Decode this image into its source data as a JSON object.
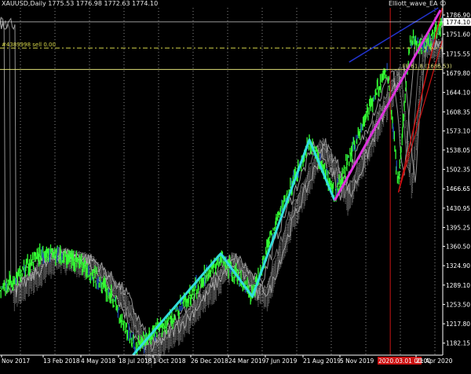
{
  "header": {
    "symbol_info": "XAUUSD,Daily  1775.53 1776.98 1772.63 1774.10",
    "ea_name": "Elliott_wave_EA ☺"
  },
  "order_line_label": "#4389998 sell 0.00",
  "fib_label": "FE 61.8 (1686.53)",
  "time_marker_label": "2020.03.01 00:00",
  "colors": {
    "background": "#000000",
    "price_axis": "#ffffff",
    "bull_candle": "#33ff33",
    "wave_primary": "#33dddd",
    "wave_secondary": "#dd33dd",
    "trend_blue": "#2233cc",
    "trend_red": "#cc1111",
    "cloud": "#bbbbbb",
    "order_line": "#d8d84a",
    "fib_line": "#e0e07a"
  },
  "chart_data": {
    "type": "line",
    "symbol": "XAUUSD",
    "timeframe": "Daily",
    "price_axis": {
      "ticks": [
        1786.9,
        1774.1,
        1751.6,
        1715.55,
        1679.8,
        1644.1,
        1608.35,
        1573.1,
        1538.05,
        1502.35,
        1466.65,
        1430.95,
        1395.25,
        1360.5,
        1324.9,
        1289.1,
        1253.5,
        1217.8,
        1182.15
      ],
      "tick_labels": [
        "1786.90",
        "1774.10",
        "1751.60",
        "1715.55",
        "1679.80",
        "1644.10",
        "1608.35",
        "1573.10",
        "1538.05",
        "1502.35",
        "1466.65",
        "1430.95",
        "1395.25",
        "1360.50",
        "1324.90",
        "1289.10",
        "1253.50",
        "1217.80",
        "1182.15"
      ],
      "current_price": 1774.1,
      "ylim": [
        1160,
        1800
      ]
    },
    "time_axis": {
      "tick_labels": [
        "Nov 2017",
        "13 Feb 2018",
        "4 May 2018",
        "18 Jul 2018",
        "1 Oct 2018",
        "26 Dec 2018",
        "24 Mar 2019",
        "7 Jun 2019",
        "21 Aug 2019",
        "5 Nov 2019",
        "2020.03.01 00:00",
        "21 Apr 2020"
      ],
      "xlim": [
        "2017-10-20",
        "2020-06-25"
      ]
    },
    "elliott_wave_primary": {
      "x": [
        "2018-08-10",
        "2019-02-20",
        "2019-05-01",
        "2019-09-04",
        "2019-10-30"
      ],
      "y": [
        1160,
        1347,
        1268,
        1557,
        1445
      ]
    },
    "elliott_wave_secondary": {
      "x": [
        "2019-10-30",
        "2020-06-20"
      ],
      "y": [
        1445,
        1796
      ]
    },
    "horizontal_levels": [
      {
        "label": "#4389998 sell 0.00",
        "price": 1726
      },
      {
        "label": "FE 61.8 (1686.53)",
        "price": 1686.53
      }
    ],
    "time_marker": "2020-03-01",
    "grid": true,
    "gridlines": "vertical dashed"
  }
}
